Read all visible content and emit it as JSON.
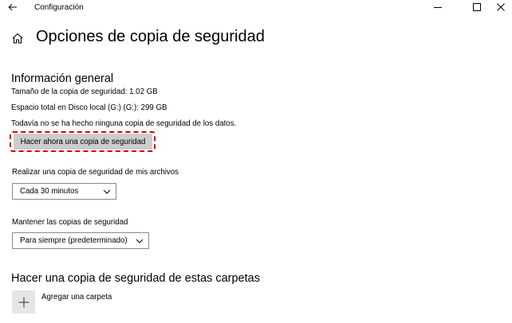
{
  "window": {
    "title": "Configuración"
  },
  "page": {
    "title": "Opciones de copia de seguridad"
  },
  "overview": {
    "heading": "Información general",
    "backup_size": "Tamaño de la copia de seguridad: 1.02 GB",
    "total_space": "Espacio total en Disco local (G:) (G:): 299 GB",
    "status": "Todavía no se ha hecho ninguna copia de seguridad de los datos.",
    "backup_now_label": "Hacer ahora una copia de seguridad"
  },
  "frequency": {
    "label": "Realizar una copia de seguridad de mis archivos",
    "selected": "Cada 30 minutos"
  },
  "retention": {
    "label": "Mantener las copias de seguridad",
    "selected": "Para siempre (predeterminado)"
  },
  "folders": {
    "heading": "Hacer una copia de seguridad de estas carpetas",
    "add_label": "Agregar una carpeta"
  },
  "colors": {
    "highlight": "#d40000",
    "button_bg": "#cccccc",
    "tile_bg": "#e6e6e6"
  },
  "icons": {
    "back": "back-arrow-icon",
    "home": "home-icon",
    "minimize": "minimize-icon",
    "maximize": "maximize-icon",
    "close": "close-icon",
    "dropdown": "chevron-down-icon",
    "add": "plus-icon"
  }
}
